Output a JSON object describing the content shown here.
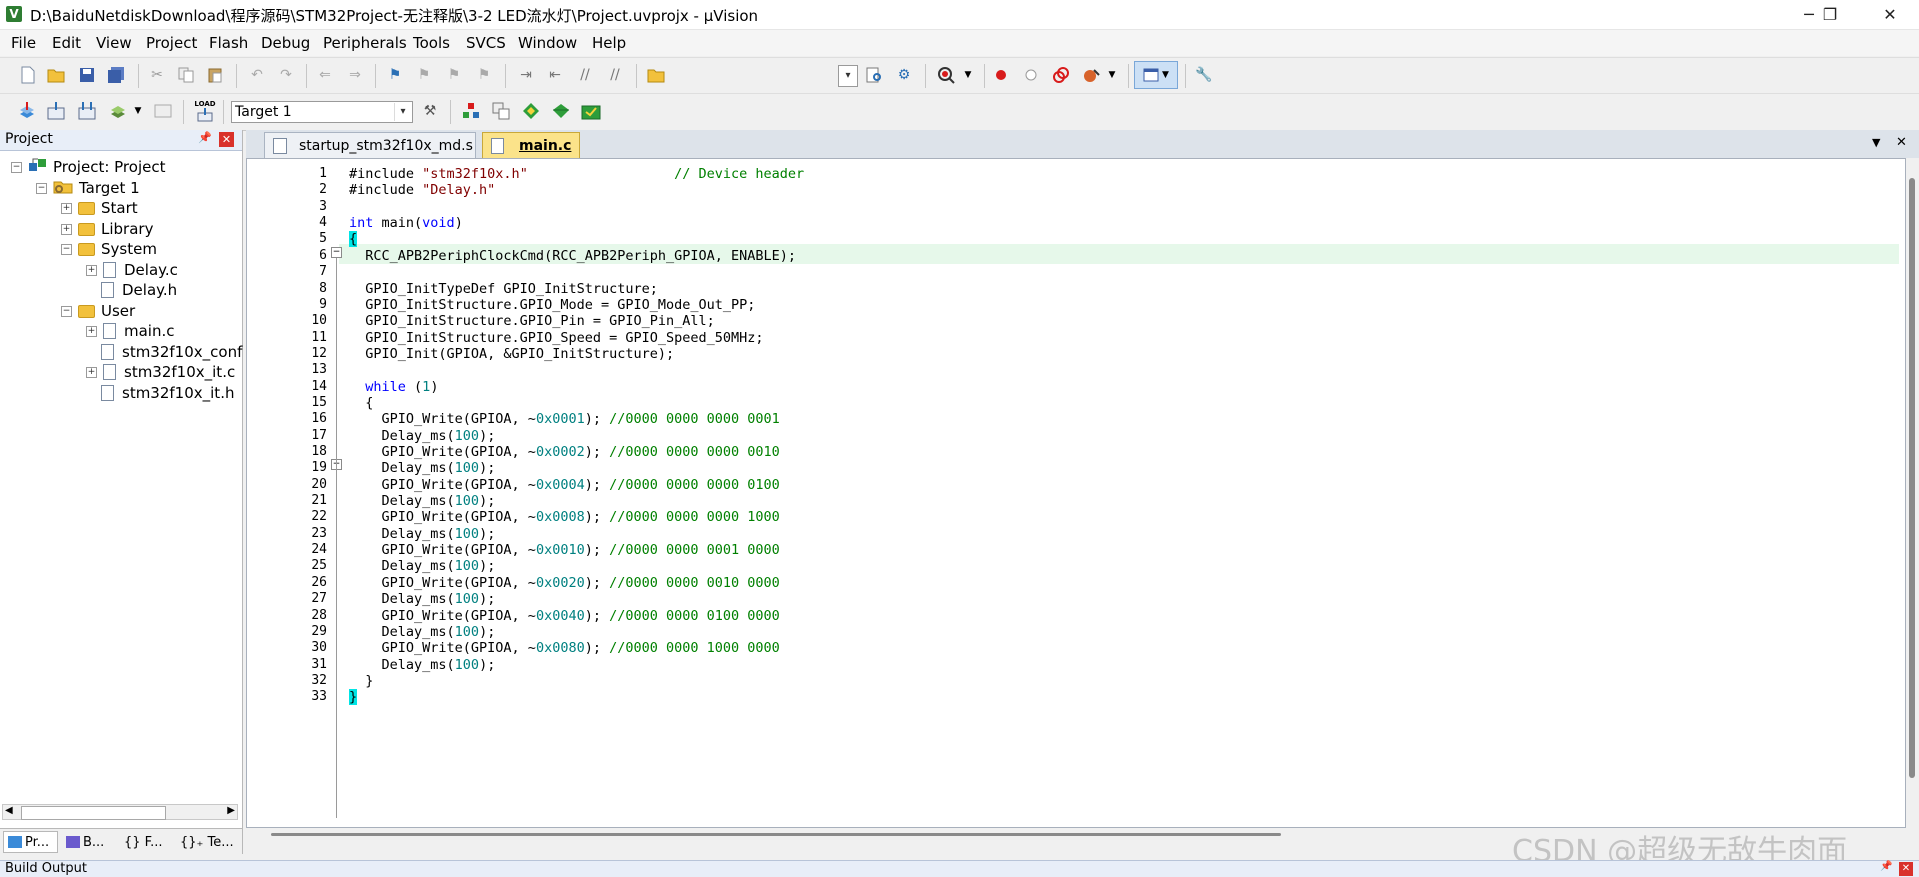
{
  "window": {
    "title": "D:\\BaiduNetdiskDownload\\程序源码\\STM32Project-无注释版\\3-2 LED流水灯\\Project.uvprojx - µVision",
    "app_icon": "V",
    "minimize_icon": "─",
    "maximize_icon": "❐",
    "close_icon": "✕"
  },
  "menu": [
    "File",
    "Edit",
    "View",
    "Project",
    "Flash",
    "Debug",
    "Peripherals",
    "Tools",
    "SVCS",
    "Window",
    "Help"
  ],
  "toolbar2": {
    "target_combo_value": "Target 1",
    "load_label": "LOAD"
  },
  "project_panel": {
    "title": "Project",
    "pin_icon": "📌",
    "close_icon": "✕",
    "tree": [
      {
        "label": "Project: Project",
        "level": 0,
        "type": "root",
        "expander": "−"
      },
      {
        "label": "Target 1",
        "level": 1,
        "type": "target",
        "expander": "−"
      },
      {
        "label": "Start",
        "level": 2,
        "type": "folder",
        "expander": "+"
      },
      {
        "label": "Library",
        "level": 2,
        "type": "folder",
        "expander": "+"
      },
      {
        "label": "System",
        "level": 2,
        "type": "folder",
        "expander": "−"
      },
      {
        "label": "Delay.c",
        "level": 3,
        "type": "file",
        "expander": "+"
      },
      {
        "label": "Delay.h",
        "level": 3,
        "type": "file",
        "expander": ""
      },
      {
        "label": "User",
        "level": 2,
        "type": "folder",
        "expander": "−"
      },
      {
        "label": "main.c",
        "level": 3,
        "type": "file",
        "expander": "+"
      },
      {
        "label": "stm32f10x_conf",
        "level": 3,
        "type": "file",
        "expander": ""
      },
      {
        "label": "stm32f10x_it.c",
        "level": 3,
        "type": "file",
        "expander": "+"
      },
      {
        "label": "stm32f10x_it.h",
        "level": 3,
        "type": "file",
        "expander": ""
      }
    ],
    "bottom_tabs": [
      "Pr...",
      "B...",
      "{} F...",
      "{}₊ Te..."
    ]
  },
  "editor": {
    "tabs": [
      {
        "label": "startup_stm32f10x_md.s",
        "active": false
      },
      {
        "label": "main.c",
        "active": true
      }
    ],
    "dropdown_icon": "▼",
    "close_icon": "✕",
    "lines": [
      {
        "n": "1",
        "code": "#include \"stm32f10x.h\"                  // Device header"
      },
      {
        "n": "2",
        "code": "#include \"Delay.h\""
      },
      {
        "n": "3",
        "code": ""
      },
      {
        "n": "4",
        "code": "int main(void)"
      },
      {
        "n": "5",
        "code": "{"
      },
      {
        "n": "6",
        "code": "  RCC_APB2PeriphClockCmd(RCC_APB2Periph_GPIOA, ENABLE);"
      },
      {
        "n": "7",
        "code": ""
      },
      {
        "n": "8",
        "code": "  GPIO_InitTypeDef GPIO_InitStructure;"
      },
      {
        "n": "9",
        "code": "  GPIO_InitStructure.GPIO_Mode = GPIO_Mode_Out_PP;"
      },
      {
        "n": "10",
        "code": "  GPIO_InitStructure.GPIO_Pin = GPIO_Pin_All;"
      },
      {
        "n": "11",
        "code": "  GPIO_InitStructure.GPIO_Speed = GPIO_Speed_50MHz;"
      },
      {
        "n": "12",
        "code": "  GPIO_Init(GPIOA, &GPIO_InitStructure);"
      },
      {
        "n": "13",
        "code": ""
      },
      {
        "n": "14",
        "code": "  while (1)"
      },
      {
        "n": "15",
        "code": "  {"
      },
      {
        "n": "16",
        "code": "    GPIO_Write(GPIOA, ~0x0001); //0000 0000 0000 0001"
      },
      {
        "n": "17",
        "code": "    Delay_ms(100);"
      },
      {
        "n": "18",
        "code": "    GPIO_Write(GPIOA, ~0x0002); //0000 0000 0000 0010"
      },
      {
        "n": "19",
        "code": "    Delay_ms(100);"
      },
      {
        "n": "20",
        "code": "    GPIO_Write(GPIOA, ~0x0004); //0000 0000 0000 0100"
      },
      {
        "n": "21",
        "code": "    Delay_ms(100);"
      },
      {
        "n": "22",
        "code": "    GPIO_Write(GPIOA, ~0x0008); //0000 0000 0000 1000"
      },
      {
        "n": "23",
        "code": "    Delay_ms(100);"
      },
      {
        "n": "24",
        "code": "    GPIO_Write(GPIOA, ~0x0010); //0000 0000 0001 0000"
      },
      {
        "n": "25",
        "code": "    Delay_ms(100);"
      },
      {
        "n": "26",
        "code": "    GPIO_Write(GPIOA, ~0x0020); //0000 0000 0010 0000"
      },
      {
        "n": "27",
        "code": "    Delay_ms(100);"
      },
      {
        "n": "28",
        "code": "    GPIO_Write(GPIOA, ~0x0040); //0000 0000 0100 0000"
      },
      {
        "n": "29",
        "code": "    Delay_ms(100);"
      },
      {
        "n": "30",
        "code": "    GPIO_Write(GPIOA, ~0x0080); //0000 0000 1000 0000"
      },
      {
        "n": "31",
        "code": "    Delay_ms(100);"
      },
      {
        "n": "32",
        "code": "  }"
      },
      {
        "n": "33",
        "code": "}"
      }
    ]
  },
  "build_output": {
    "title": "Build Output"
  },
  "watermark": "CSDN @超级无敌牛肉面",
  "colors": {
    "keyword": "#0000ff",
    "string": "#800000",
    "comment": "#008000",
    "number": "#008080",
    "current_line": "#e6f8ea",
    "brace_match": "#00e5e5"
  }
}
